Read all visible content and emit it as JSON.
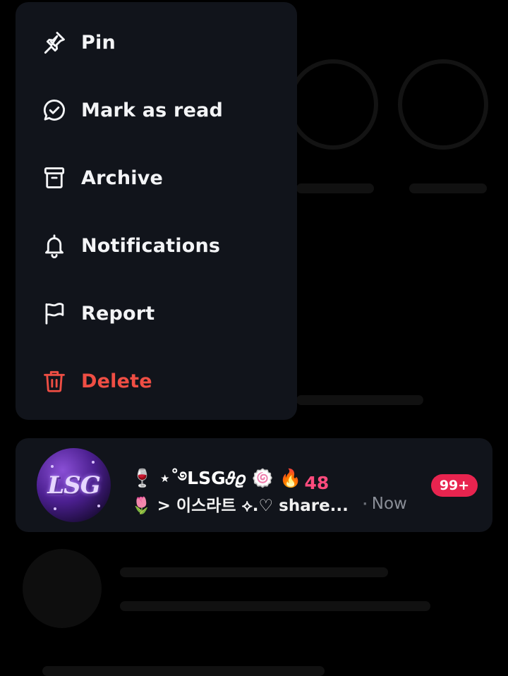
{
  "menu": {
    "items": [
      {
        "label": "Pin",
        "icon": "pin-icon"
      },
      {
        "label": "Mark as read",
        "icon": "mark-read-icon"
      },
      {
        "label": "Archive",
        "icon": "archive-icon"
      },
      {
        "label": "Notifications",
        "icon": "bell-icon"
      },
      {
        "label": "Report",
        "icon": "flag-icon"
      },
      {
        "label": "Delete",
        "icon": "trash-icon"
      }
    ],
    "danger_color": "#ef4e44"
  },
  "chat": {
    "title_prefix": "🍷 ⋆˚࿔LSG𝜗𝜚 🍥 🔥",
    "streak": "48",
    "preview": "🌷 > 이스라트 ⟡.♡ share...",
    "separator": "·",
    "time": "Now",
    "unread": "99+",
    "avatar_text": "LSG"
  },
  "colors": {
    "badge": "#e8244f",
    "streak": "#ff4b7d",
    "surface": "#11141b"
  }
}
